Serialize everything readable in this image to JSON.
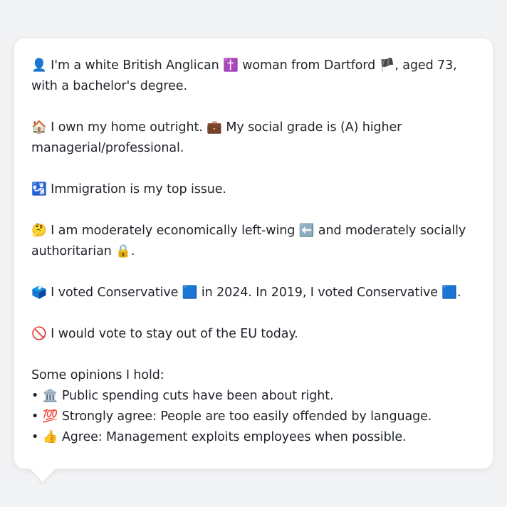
{
  "card": {
    "intro": {
      "emoji_person": "👤",
      "text_a": " I'm a white British Anglican ",
      "emoji_cross": "✝️",
      "text_b": " woman from Dartford ",
      "emoji_flag": "🏴",
      "text_c": ", aged 73, with a bachelor's degree."
    },
    "home": {
      "emoji_house": "🏠",
      "text_a": " I own my home outright. ",
      "emoji_briefcase": "💼",
      "text_b": " My social grade is (A) higher managerial/professional."
    },
    "issue": {
      "emoji": "🛂",
      "text": " Immigration is my top issue."
    },
    "ideology": {
      "emoji_think": "🤔",
      "text_a": " I am moderately economically left-wing ",
      "emoji_left": "⬅️",
      "text_b": " and moderately socially authoritarian ",
      "emoji_lock": "🔒",
      "text_c": "."
    },
    "vote": {
      "emoji_ballot": "🗳️",
      "text_a": " I voted Conservative ",
      "emoji_blue1": "🟦",
      "text_b": " in 2024. In 2019, I voted Conservative ",
      "emoji_blue2": "🟦",
      "text_c": "."
    },
    "eu": {
      "emoji": "🚫",
      "text": " I would vote to stay out of the EU today."
    },
    "opinions_heading": "Some opinions I hold:",
    "opinions": [
      {
        "bullet": "• ",
        "emoji": "🏛️",
        "text": " Public spending cuts have been about right."
      },
      {
        "bullet": "• ",
        "emoji": "💯",
        "text": " Strongly agree: People are too easily offended by language."
      },
      {
        "bullet": "• ",
        "emoji": "👍",
        "text": " Agree: Management exploits employees when possible."
      }
    ]
  }
}
